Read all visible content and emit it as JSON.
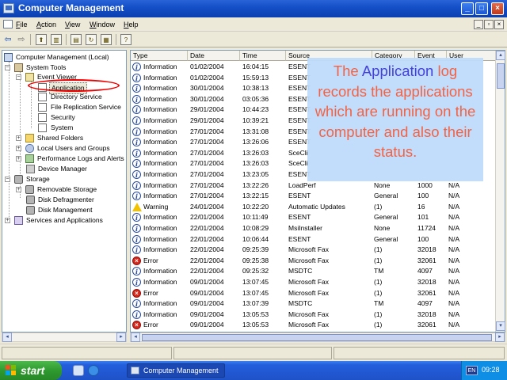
{
  "window": {
    "title": "Computer Management"
  },
  "menu": {
    "items": [
      "File",
      "Action",
      "View",
      "Window",
      "Help"
    ]
  },
  "tree": {
    "root": "Computer Management (Local)",
    "system_tools": "System Tools",
    "event_viewer": "Event Viewer",
    "application": "Application",
    "directory_service": "Directory Service",
    "file_replication_service": "File Replication Service",
    "security": "Security",
    "system": "System",
    "shared_folders": "Shared Folders",
    "local_users_groups": "Local Users and Groups",
    "perf_logs": "Performance Logs and Alerts",
    "device_manager": "Device Manager",
    "storage": "Storage",
    "removable_storage": "Removable Storage",
    "disk_defragmenter": "Disk Defragmenter",
    "disk_management": "Disk Management",
    "services_apps": "Services and Applications"
  },
  "columns": [
    "Type",
    "Date",
    "Time",
    "Source",
    "Category",
    "Event",
    "User"
  ],
  "events": [
    {
      "type": "Information",
      "date": "01/02/2004",
      "time": "16:04:15",
      "source": "ESENT",
      "category": "",
      "event": "",
      "user": ""
    },
    {
      "type": "Information",
      "date": "01/02/2004",
      "time": "15:59:13",
      "source": "ESENT",
      "category": "",
      "event": "",
      "user": ""
    },
    {
      "type": "Information",
      "date": "30/01/2004",
      "time": "10:38:13",
      "source": "ESENT",
      "category": "",
      "event": "",
      "user": ""
    },
    {
      "type": "Information",
      "date": "30/01/2004",
      "time": "03:05:36",
      "source": "ESENT",
      "category": "",
      "event": "",
      "user": ""
    },
    {
      "type": "Information",
      "date": "29/01/2004",
      "time": "10:44:23",
      "source": "ESENT",
      "category": "",
      "event": "",
      "user": ""
    },
    {
      "type": "Information",
      "date": "29/01/2004",
      "time": "10:39:21",
      "source": "ESENT",
      "category": "",
      "event": "",
      "user": ""
    },
    {
      "type": "Information",
      "date": "27/01/2004",
      "time": "13:31:08",
      "source": "ESENT",
      "category": "",
      "event": "",
      "user": ""
    },
    {
      "type": "Information",
      "date": "27/01/2004",
      "time": "13:26:06",
      "source": "ESENT",
      "category": "",
      "event": "",
      "user": ""
    },
    {
      "type": "Information",
      "date": "27/01/2004",
      "time": "13:26:03",
      "source": "SceCli",
      "category": "",
      "event": "",
      "user": ""
    },
    {
      "type": "Information",
      "date": "27/01/2004",
      "time": "13:26:03",
      "source": "SceCli",
      "category": "",
      "event": "",
      "user": ""
    },
    {
      "type": "Information",
      "date": "27/01/2004",
      "time": "13:23:05",
      "source": "ESENT",
      "category": "",
      "event": "",
      "user": ""
    },
    {
      "type": "Information",
      "date": "27/01/2004",
      "time": "13:22:26",
      "source": "LoadPerf",
      "category": "None",
      "event": "1000",
      "user": "N/A"
    },
    {
      "type": "Information",
      "date": "27/01/2004",
      "time": "13:22:15",
      "source": "ESENT",
      "category": "General",
      "event": "100",
      "user": "N/A"
    },
    {
      "type": "Warning",
      "date": "24/01/2004",
      "time": "10:22:20",
      "source": "Automatic Updates",
      "category": "(1)",
      "event": "16",
      "user": "N/A"
    },
    {
      "type": "Information",
      "date": "22/01/2004",
      "time": "10:11:49",
      "source": "ESENT",
      "category": "General",
      "event": "101",
      "user": "N/A"
    },
    {
      "type": "Information",
      "date": "22/01/2004",
      "time": "10:08:29",
      "source": "MsiInstaller",
      "category": "None",
      "event": "11724",
      "user": "N/A"
    },
    {
      "type": "Information",
      "date": "22/01/2004",
      "time": "10:06:44",
      "source": "ESENT",
      "category": "General",
      "event": "100",
      "user": "N/A"
    },
    {
      "type": "Information",
      "date": "22/01/2004",
      "time": "09:25:39",
      "source": "Microsoft Fax",
      "category": "(1)",
      "event": "32018",
      "user": "N/A"
    },
    {
      "type": "Error",
      "date": "22/01/2004",
      "time": "09:25:38",
      "source": "Microsoft Fax",
      "category": "(1)",
      "event": "32061",
      "user": "N/A"
    },
    {
      "type": "Information",
      "date": "22/01/2004",
      "time": "09:25:32",
      "source": "MSDTC",
      "category": "TM",
      "event": "4097",
      "user": "N/A"
    },
    {
      "type": "Information",
      "date": "09/01/2004",
      "time": "13:07:45",
      "source": "Microsoft Fax",
      "category": "(1)",
      "event": "32018",
      "user": "N/A"
    },
    {
      "type": "Error",
      "date": "09/01/2004",
      "time": "13:07:45",
      "source": "Microsoft Fax",
      "category": "(1)",
      "event": "32061",
      "user": "N/A"
    },
    {
      "type": "Information",
      "date": "09/01/2004",
      "time": "13:07:39",
      "source": "MSDTC",
      "category": "TM",
      "event": "4097",
      "user": "N/A"
    },
    {
      "type": "Information",
      "date": "09/01/2004",
      "time": "13:05:53",
      "source": "Microsoft Fax",
      "category": "(1)",
      "event": "32018",
      "user": "N/A"
    },
    {
      "type": "Error",
      "date": "09/01/2004",
      "time": "13:05:53",
      "source": "Microsoft Fax",
      "category": "(1)",
      "event": "32061",
      "user": "N/A"
    }
  ],
  "callout": {
    "before": "The ",
    "highlight": "Application",
    "after": " log records the applications which are running on the computer and also their status."
  },
  "taskbar": {
    "start": "start",
    "task_button": "Computer Management",
    "language": "EN",
    "clock": "09:28"
  },
  "colors": {
    "callout_bg": "#bfdcfb",
    "callout_text": "#f25a3a",
    "callout_highlight": "#3a37d8",
    "annotation_oval": "#e00000"
  }
}
